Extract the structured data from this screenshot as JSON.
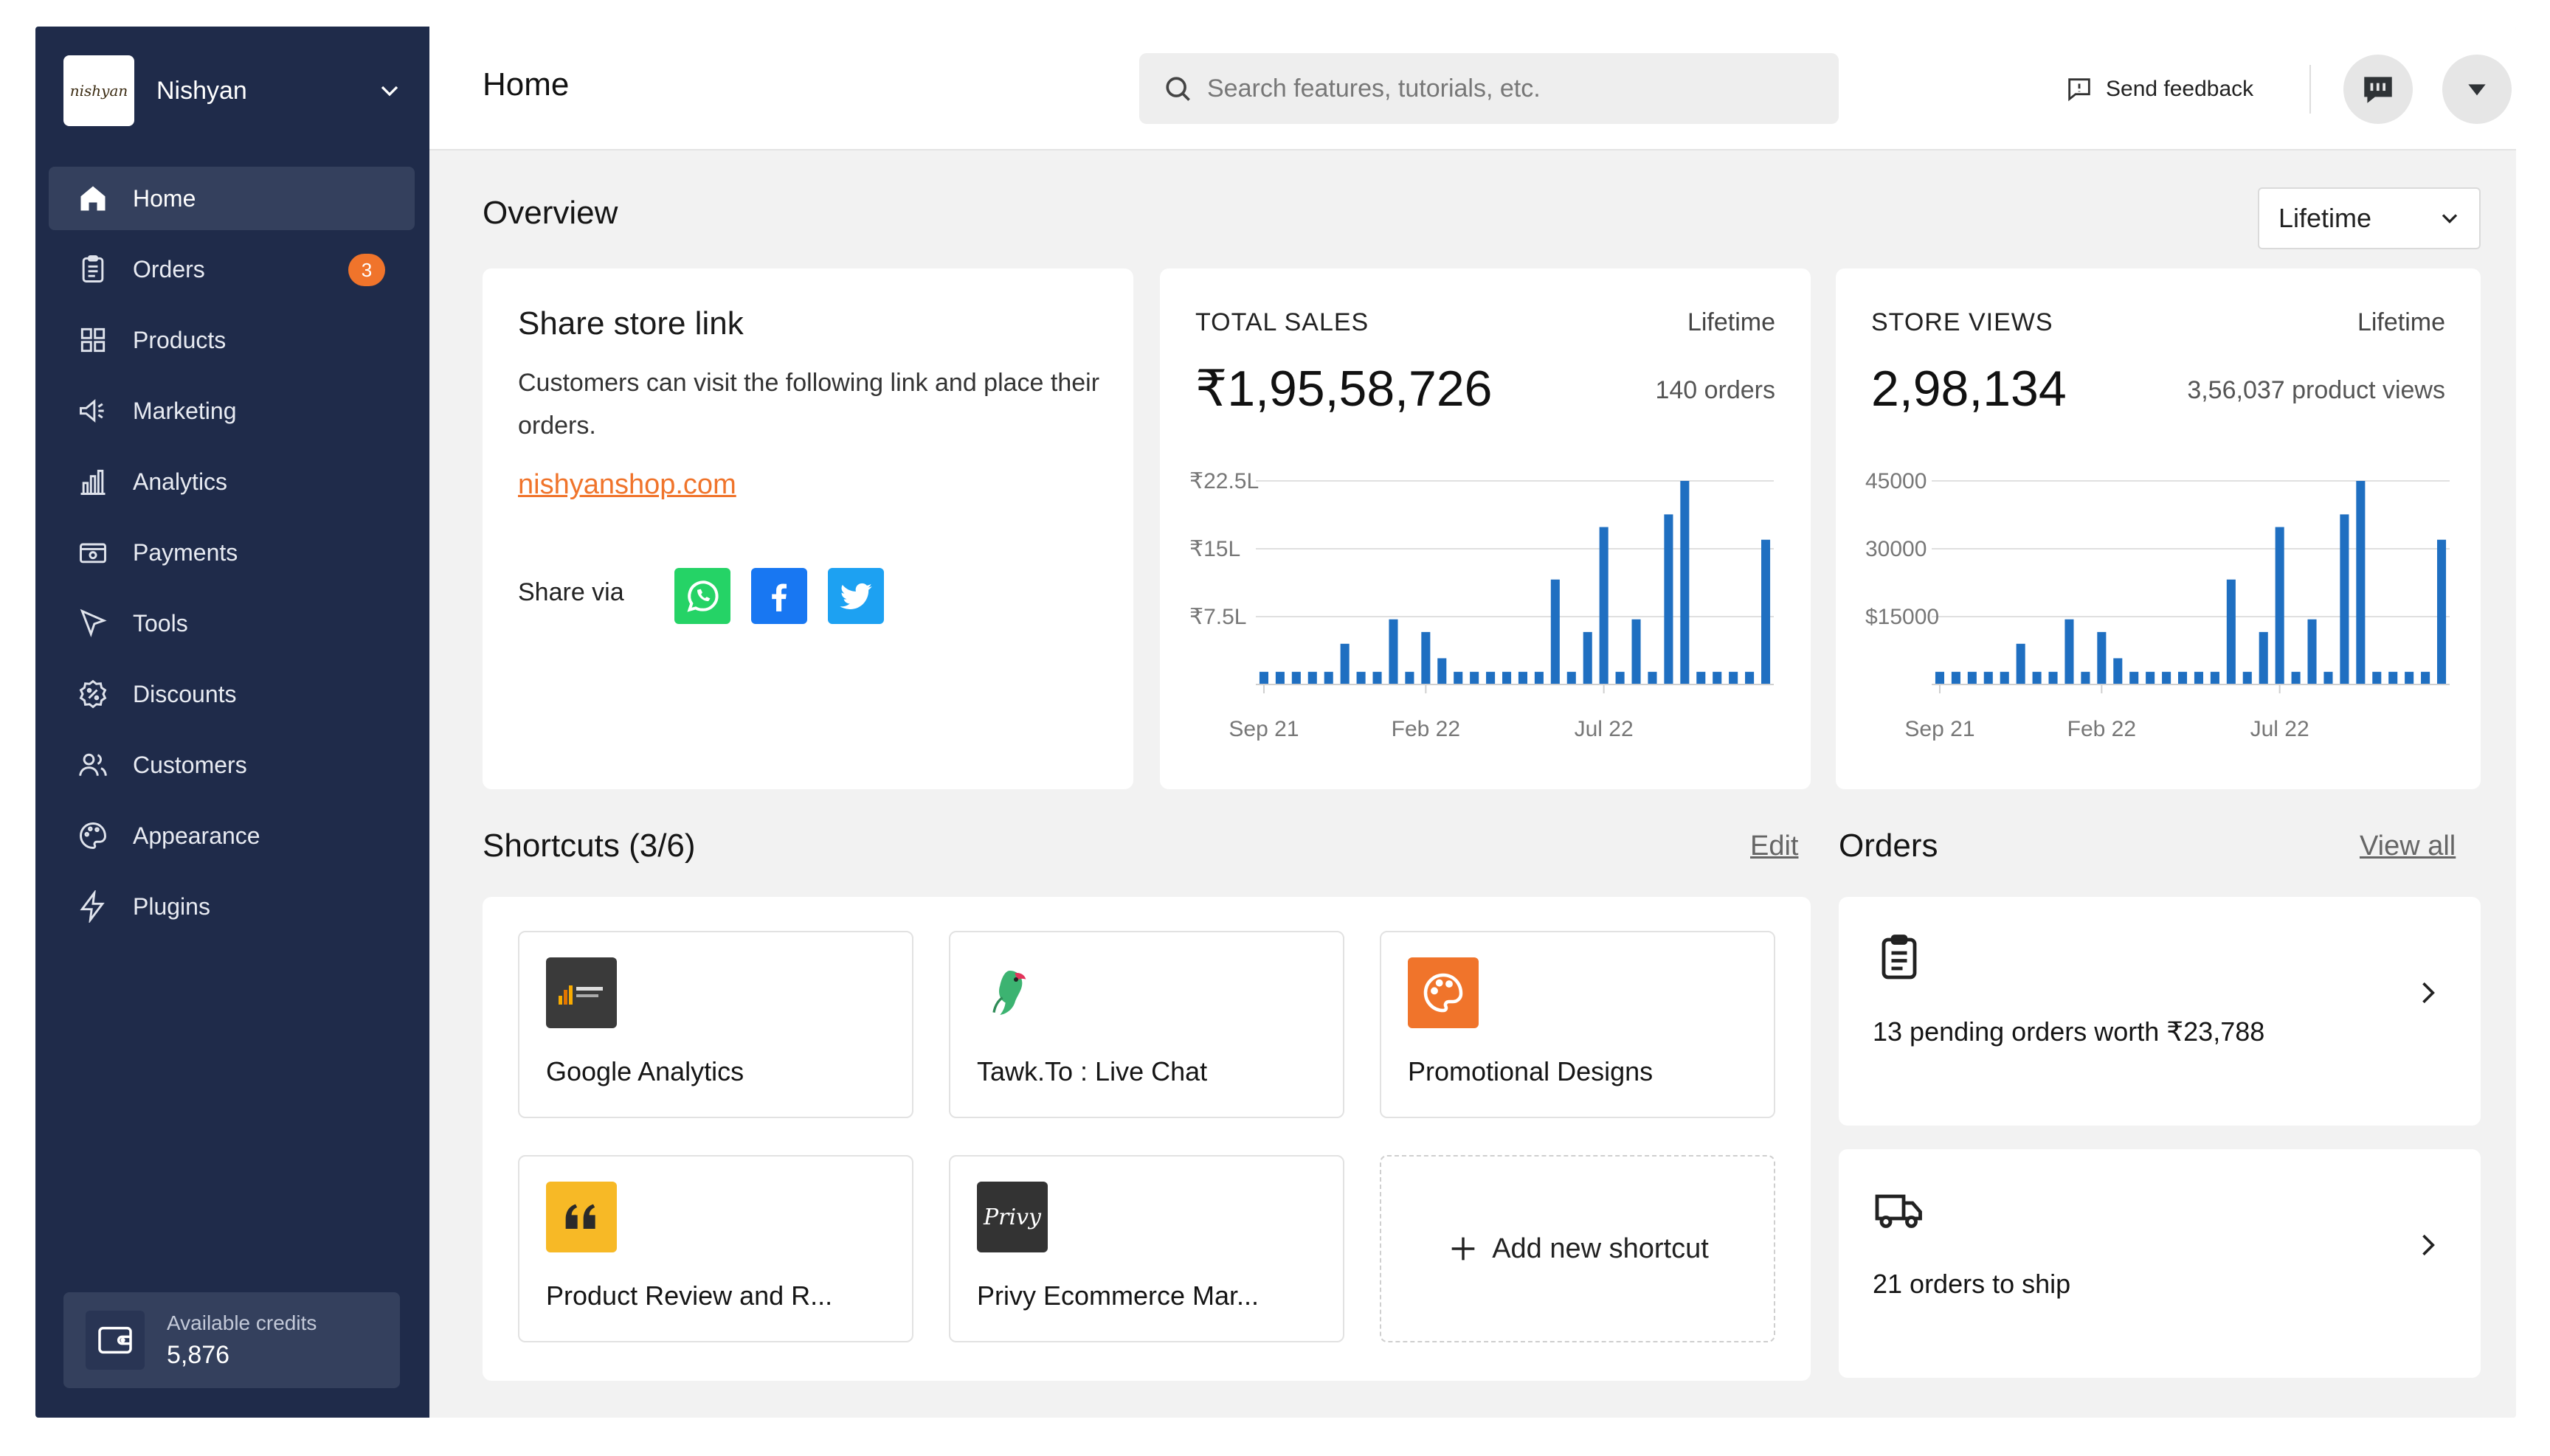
{
  "sidebar": {
    "store_logo_text": "nishyan",
    "store_name": "Nishyan",
    "items": [
      {
        "label": "Home"
      },
      {
        "label": "Orders",
        "badge": "3"
      },
      {
        "label": "Products"
      },
      {
        "label": "Marketing"
      },
      {
        "label": "Analytics"
      },
      {
        "label": "Payments"
      },
      {
        "label": "Tools"
      },
      {
        "label": "Discounts"
      },
      {
        "label": "Customers"
      },
      {
        "label": "Appearance"
      },
      {
        "label": "Plugins"
      }
    ],
    "credits": {
      "label": "Available credits",
      "value": "5,876"
    }
  },
  "header": {
    "title": "Home",
    "search_placeholder": "Search features, tutorials, etc.",
    "feedback_label": "Send feedback"
  },
  "overview": {
    "title": "Overview",
    "period": "Lifetime",
    "share": {
      "title": "Share store link",
      "description": "Customers can visit the following link and place their orders.",
      "link": "nishyanshop.com",
      "via_label": "Share via"
    },
    "sales": {
      "label": "TOTAL SALES",
      "period": "Lifetime",
      "value": "₹1,95,58,726",
      "sub": "140 orders"
    },
    "views": {
      "label": "STORE VIEWS",
      "period": "Lifetime",
      "value": "2,98,134",
      "sub": "3,56,037 product views"
    }
  },
  "chart_data": [
    {
      "type": "bar",
      "y_ticks": [
        "₹22.5L",
        "₹15L",
        "₹7.5L"
      ],
      "y_tick_values": [
        22.5,
        15,
        7.5
      ],
      "ylim": [
        0,
        22.5
      ],
      "x_ticks": [
        "Sep 21",
        "Feb 22",
        "Jul 22"
      ],
      "x_tick_index": [
        0,
        10,
        21
      ],
      "values": [
        1.4,
        1.4,
        1.4,
        1.4,
        1.4,
        4.5,
        1.4,
        1.4,
        7.2,
        1.4,
        5.8,
        2.9,
        1.4,
        1.4,
        1.4,
        1.4,
        1.4,
        1.4,
        11.6,
        1.4,
        5.8,
        17.4,
        1.4,
        7.2,
        1.4,
        18.8,
        22.5,
        1.4,
        1.4,
        1.4,
        1.4,
        16.0
      ],
      "color": "#1f6fc1"
    },
    {
      "type": "bar",
      "y_ticks": [
        "45000",
        "30000",
        "$15000"
      ],
      "y_tick_values": [
        45000,
        30000,
        15000
      ],
      "ylim": [
        0,
        45000
      ],
      "x_ticks": [
        "Sep 21",
        "Feb 22",
        "Jul 22"
      ],
      "x_tick_index": [
        0,
        10,
        21
      ],
      "values": [
        2800,
        2800,
        2800,
        2800,
        2800,
        9000,
        2800,
        2800,
        14400,
        2800,
        11600,
        5800,
        2800,
        2800,
        2800,
        2800,
        2800,
        2800,
        23200,
        2800,
        11600,
        34800,
        2800,
        14400,
        2800,
        37600,
        45000,
        2800,
        2800,
        2800,
        2800,
        32000
      ],
      "color": "#1f6fc1"
    }
  ],
  "shortcuts": {
    "title": "Shortcuts (3/6)",
    "edit_label": "Edit",
    "items": [
      {
        "label": "Google Analytics",
        "icon": "google-analytics-icon"
      },
      {
        "label": "Tawk.To : Live Chat",
        "icon": "parrot-icon"
      },
      {
        "label": "Promotional Designs",
        "icon": "palette-icon"
      },
      {
        "label": "Product Review and R...",
        "icon": "quote-icon"
      },
      {
        "label": "Privy Ecommerce Mar...",
        "icon": "privy-icon",
        "icon_text": "Privy"
      }
    ],
    "add_label": "Add new shortcut"
  },
  "orders": {
    "title": "Orders",
    "view_all_label": "View all",
    "cards": [
      {
        "text": "13 pending orders worth ₹23,788",
        "icon": "clipboard-icon"
      },
      {
        "text": "21 orders to ship",
        "icon": "truck-icon"
      }
    ]
  },
  "colors": {
    "sidebar_bg": "#1f2b4a",
    "accent": "#f0742b",
    "bar": "#1f6fc1",
    "whatsapp": "#25d366",
    "facebook": "#1877f2",
    "twitter": "#1da1f2"
  }
}
